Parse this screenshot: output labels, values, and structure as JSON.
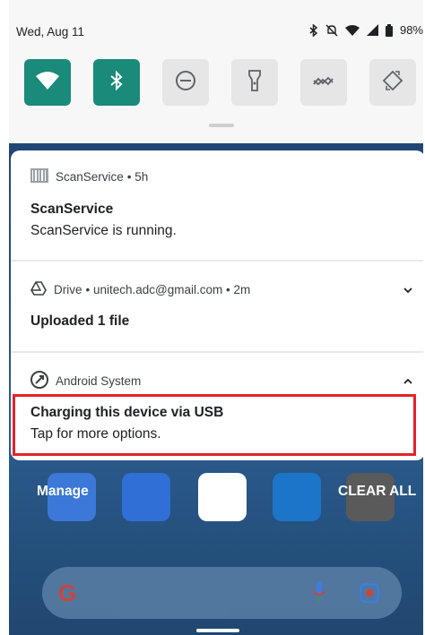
{
  "status_bar": {
    "date": "Wed, Aug 11",
    "battery": "98%"
  },
  "quick_settings": {
    "tiles": [
      {
        "name": "wifi-icon",
        "active": true
      },
      {
        "name": "bluetooth-icon",
        "active": true
      },
      {
        "name": "do-not-disturb-icon",
        "active": false
      },
      {
        "name": "flashlight-icon",
        "active": false
      },
      {
        "name": "data-saver-icon",
        "active": false
      },
      {
        "name": "auto-rotate-icon",
        "active": false
      }
    ]
  },
  "notifications": [
    {
      "app": "ScanService",
      "meta": "• 5h",
      "title": "ScanService",
      "text": "ScanService is running."
    },
    {
      "app": "Drive",
      "meta": "• unitech.adc@gmail.com • 2m",
      "title": "Uploaded 1 file",
      "text": ""
    },
    {
      "app": "Android System",
      "meta": "",
      "title": "Charging this device via USB",
      "text": "Tap for more options."
    }
  ],
  "actions": {
    "manage": "Manage",
    "clear_all": "CLEAR ALL"
  },
  "colors": {
    "accent": "#1a8a7b",
    "highlight": "#e3232a",
    "wallpaper": "#244f80"
  }
}
